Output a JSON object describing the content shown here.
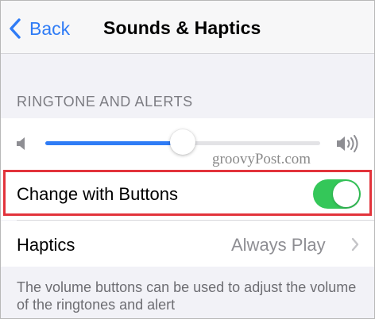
{
  "nav": {
    "back_label": "Back",
    "title": "Sounds & Haptics"
  },
  "section": {
    "header": "RINGTONE AND ALERTS"
  },
  "volume": {
    "level_fraction": 0.5,
    "low_icon": "speaker-low-icon",
    "high_icon": "speaker-high-icon"
  },
  "change_with_buttons": {
    "label": "Change with Buttons",
    "enabled": true
  },
  "haptics": {
    "label": "Haptics",
    "value": "Always Play"
  },
  "footer": {
    "text": "The volume buttons can be used to adjust the volume of the ringtones and alert"
  },
  "watermark": {
    "text": "groovyPost.com"
  },
  "colors": {
    "accent": "#2f7cf6",
    "toggle_on": "#34c759",
    "highlight": "#e2333b",
    "background": "#f2f2f7"
  }
}
